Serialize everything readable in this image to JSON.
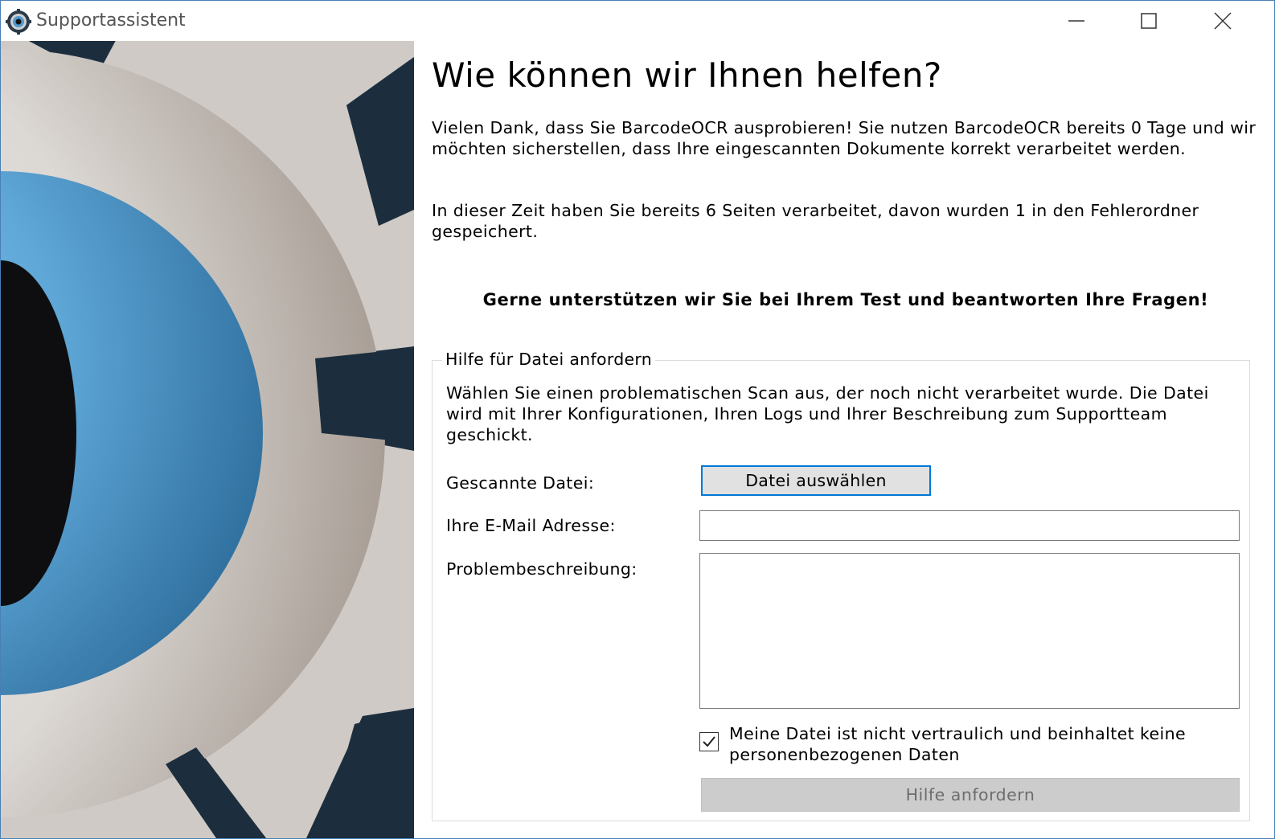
{
  "window": {
    "title": "Supportassistent",
    "app_icon": "gear-eye-icon",
    "controls": {
      "minimize": "minimize-icon",
      "maximize": "maximize-icon",
      "close": "close-icon"
    }
  },
  "main": {
    "heading": "Wie können wir Ihnen helfen?",
    "intro": "Vielen Dank, dass Sie BarcodeOCR ausprobieren! Sie nutzen BarcodeOCR bereits 0 Tage und wir möchten sicherstellen, dass Ihre eingescannten Dokumente korrekt verarbeitet werden.",
    "stats": "In dieser Zeit haben Sie bereits 6 Seiten verarbeitet, davon wurden 1 in den Fehlerordner gespeichert.",
    "support_note": "Gerne unterstützen wir Sie bei Ihrem Test und beantworten Ihre Fragen!"
  },
  "help_group": {
    "legend": "Hilfe für Datei anfordern",
    "description": "Wählen Sie einen problematischen Scan aus, der noch nicht verarbeitet wurde. Die Datei wird mit Ihrer Konfigurationen, Ihren Logs und Ihrer Beschreibung zum Supportteam geschickt.",
    "file_label": "Gescannte Datei:",
    "file_button": "Datei auswählen",
    "email_label": "Ihre E-Mail Adresse:",
    "email_value": "",
    "description_label": "Problembeschreibung:",
    "description_value": "",
    "confidential_checked": true,
    "confidential_label": "Meine Datei ist nicht vertraulich und beinhaltet keine personenbezogenen Daten",
    "submit_button": "Hilfe anfordern",
    "submit_enabled": false
  },
  "colors": {
    "accent": "#0078d7",
    "eye_blue": "#5fa8d8",
    "gear_dark": "#1c2e3e",
    "disabled_button": "#cccccc"
  }
}
